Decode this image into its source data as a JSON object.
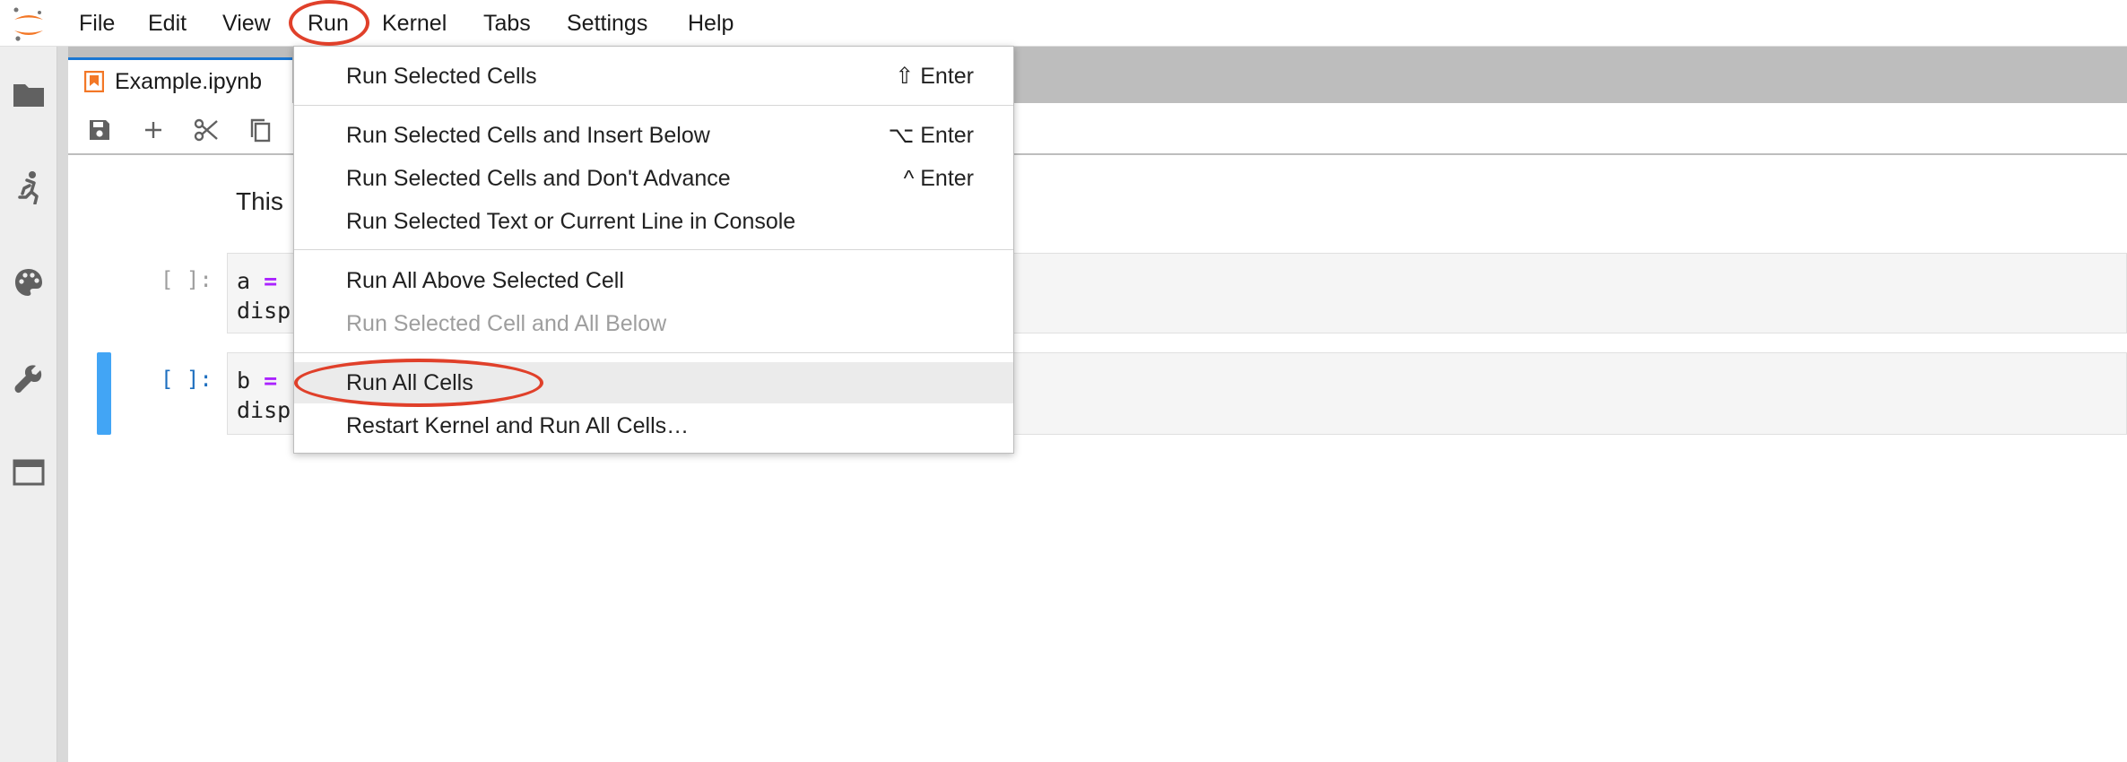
{
  "menubar": {
    "items": [
      {
        "label": "File"
      },
      {
        "label": "Edit"
      },
      {
        "label": "View"
      },
      {
        "label": "Run"
      },
      {
        "label": "Kernel"
      },
      {
        "label": "Tabs"
      },
      {
        "label": "Settings"
      },
      {
        "label": "Help"
      }
    ],
    "active": "Run"
  },
  "sidebar": {
    "icons": [
      "folder-icon",
      "running-icon",
      "palette-icon",
      "wrench-icon",
      "tabs-icon"
    ]
  },
  "tab": {
    "label": "Example.ipynb"
  },
  "notebook": {
    "markdown_text": "This",
    "cells": [
      {
        "prompt": "[ ]:",
        "line1_var": "a",
        "line1_op": "=",
        "line2": "disp"
      },
      {
        "prompt": "[ ]:",
        "line1_var": "b",
        "line1_op": "=",
        "line2": "disp"
      }
    ]
  },
  "run_menu": {
    "items": [
      {
        "label": "Run Selected Cells",
        "shortcut": "⇧ Enter"
      },
      {
        "label": "Run Selected Cells and Insert Below",
        "shortcut": "⌥ Enter"
      },
      {
        "label": "Run Selected Cells and Don't Advance",
        "shortcut": "^ Enter"
      },
      {
        "label": "Run Selected Text or Current Line in Console",
        "shortcut": ""
      },
      {
        "label": "Run All Above Selected Cell",
        "shortcut": ""
      },
      {
        "label": "Run Selected Cell and All Below",
        "shortcut": "",
        "disabled": true
      },
      {
        "label": "Run All Cells",
        "shortcut": "",
        "highlighted": true
      },
      {
        "label": "Restart Kernel and Run All Cells…",
        "shortcut": ""
      }
    ]
  },
  "colors": {
    "accent": "#1976d2",
    "annotation": "#e0402a",
    "selected_cell_bar": "#42a5f5",
    "operator": "#aa22ff"
  }
}
